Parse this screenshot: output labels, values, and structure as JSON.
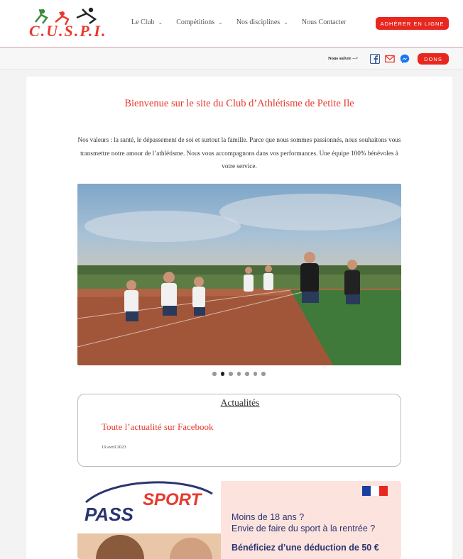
{
  "header": {
    "logo_text": "C.U.S.P.I.",
    "nav": [
      {
        "label": "Le Club"
      },
      {
        "label": "Compétitions"
      },
      {
        "label": "Nos disciplines"
      },
      {
        "label": "Nous Contacter"
      }
    ],
    "join_label": "ADHÉRER EN LIGNE"
  },
  "subbar": {
    "follow_label": "Nous suivre -->",
    "social_icons": [
      "facebook-icon",
      "mail-icon",
      "messenger-icon"
    ],
    "dons_label": "DONS"
  },
  "main": {
    "title": "Bienvenue sur le site du Club d’Athlétisme de Petite Ile",
    "intro": "Nos valeurs : la santé, le dépassement de soi et surtout la famille. Parce que nous sommes passionnés, nous souhaitons vous transmettre notre amour de l’athlétisme. Nous vous accompagnons dans vos performances. Une équipe 100% bénévoles à votre service.",
    "slider": {
      "slide_count": 7,
      "active_index": 1
    }
  },
  "news": {
    "heading": "Actualités",
    "post_title": "Toute l’actualité sur Facebook",
    "post_date": "19 avril 2023"
  },
  "pass_sport": {
    "brand_pass": "PASS",
    "brand_sport": "SPORT",
    "line1": "Moins de 18 ans ?",
    "line2": "Envie de faire du sport à la rentrée ?",
    "line3": "Bénéficiez d’une déduction de 50 €"
  },
  "colors": {
    "accent": "#e8271f",
    "title": "#e8392e",
    "pass_blue": "#2b3570"
  }
}
